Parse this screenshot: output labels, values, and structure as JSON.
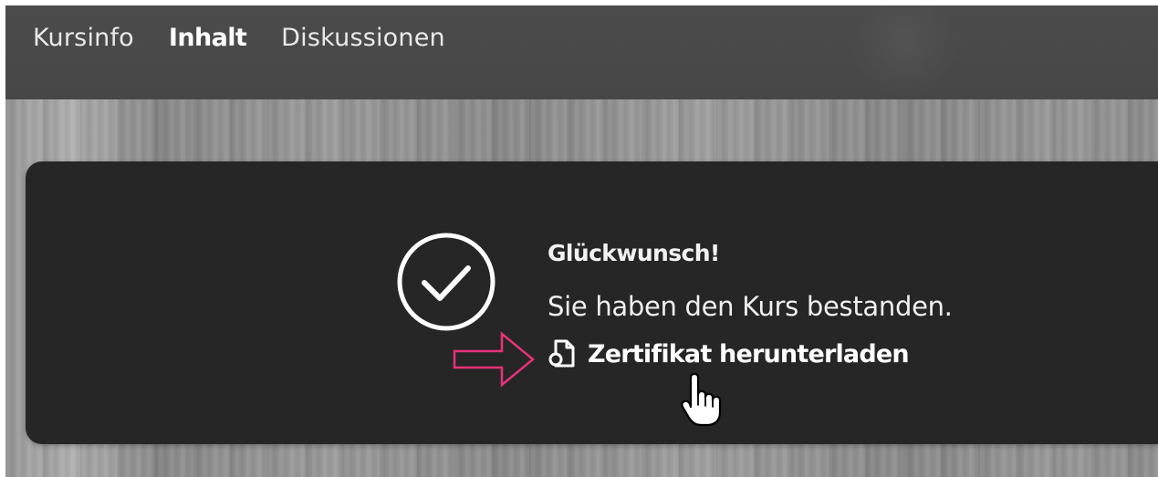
{
  "nav": {
    "tabs": [
      {
        "label": "Kursinfo",
        "active": false
      },
      {
        "label": "Inhalt",
        "active": true
      },
      {
        "label": "Diskussionen",
        "active": false
      }
    ]
  },
  "completion": {
    "icon": "check-circle-icon",
    "title": "Glückwunsch!",
    "message": "Sie haben den Kurs bestanden.",
    "download_icon": "certificate-file-icon",
    "download_label": "Zertifikat herunterladen"
  },
  "annotation": {
    "arrow_icon": "arrow-right-outline",
    "arrow_color": "#e8327a",
    "cursor_icon": "hand-pointer-cursor"
  },
  "colors": {
    "topbar": "#4a4a4a",
    "card": "#262626",
    "text": "#ffffff"
  }
}
